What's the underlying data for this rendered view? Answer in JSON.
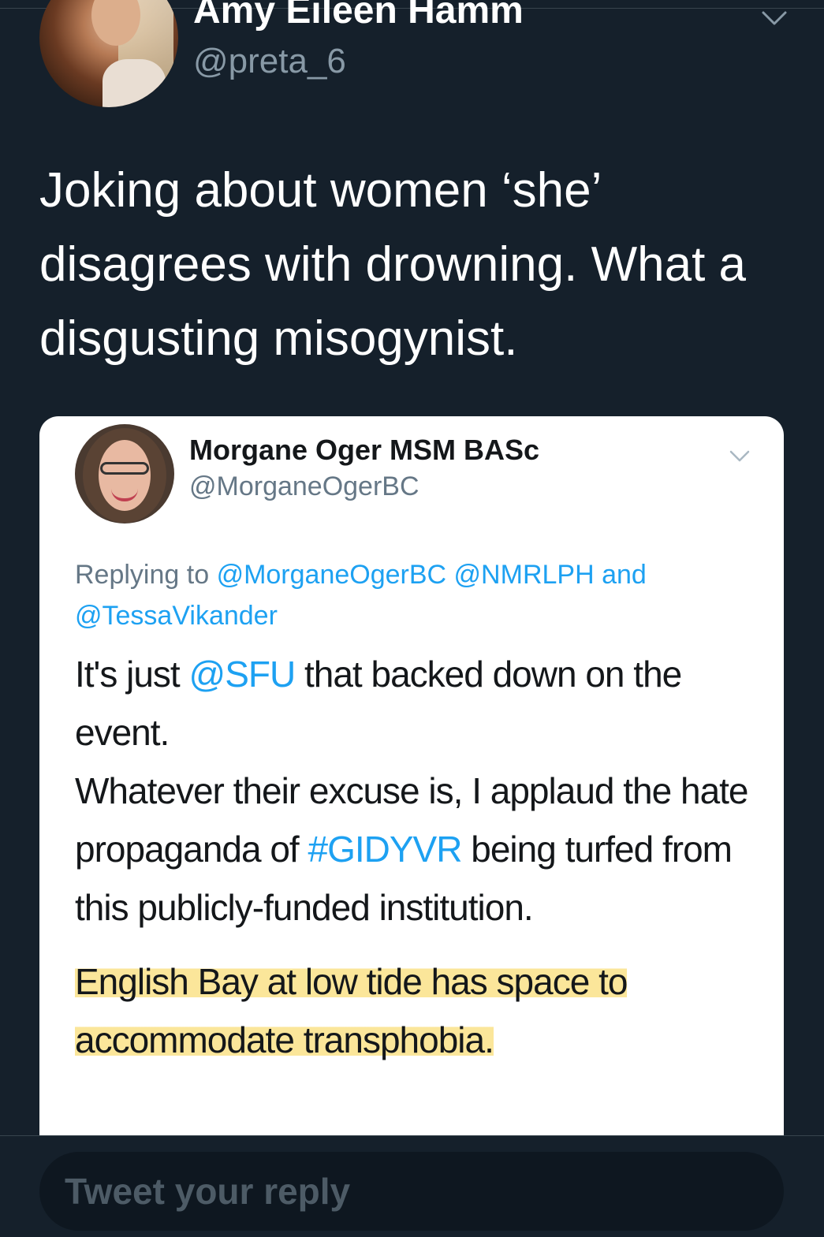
{
  "tweet": {
    "author_name": "Amy Eileen Hamm",
    "author_handle": "@preta_6",
    "text": "Joking about women ‘she’ disagrees with drowning. What a disgusting misogynist.",
    "menu_icon": "chevron-down-icon"
  },
  "embedded": {
    "author_name": "Morgane Oger MSM BASc",
    "author_handle": "@MorganeOgerBC",
    "replying_label": "Replying to",
    "replying_mentions": [
      "@MorganeOgerBC",
      "@NMRLPH",
      "@TessaVikander"
    ],
    "replying_and": "and",
    "body_p1_before": "It's just ",
    "body_p1_mention": "@SFU",
    "body_p1_after": " that backed down on the event.",
    "body_p2_before": "Whatever their excuse is, I applaud the hate propaganda of ",
    "body_p2_hashtag": "#GIDYVR",
    "body_p2_after": " being turfed from this publicly-funded institution.",
    "body_p3": "English Bay at low tide has space to accommodate transphobia.",
    "highlight_color": "#fade78",
    "link_color": "#1da1f2"
  },
  "reply": {
    "placeholder": "Tweet your reply"
  },
  "colors": {
    "background": "#15202b",
    "text": "#ffffff",
    "secondary": "#8899a6"
  }
}
